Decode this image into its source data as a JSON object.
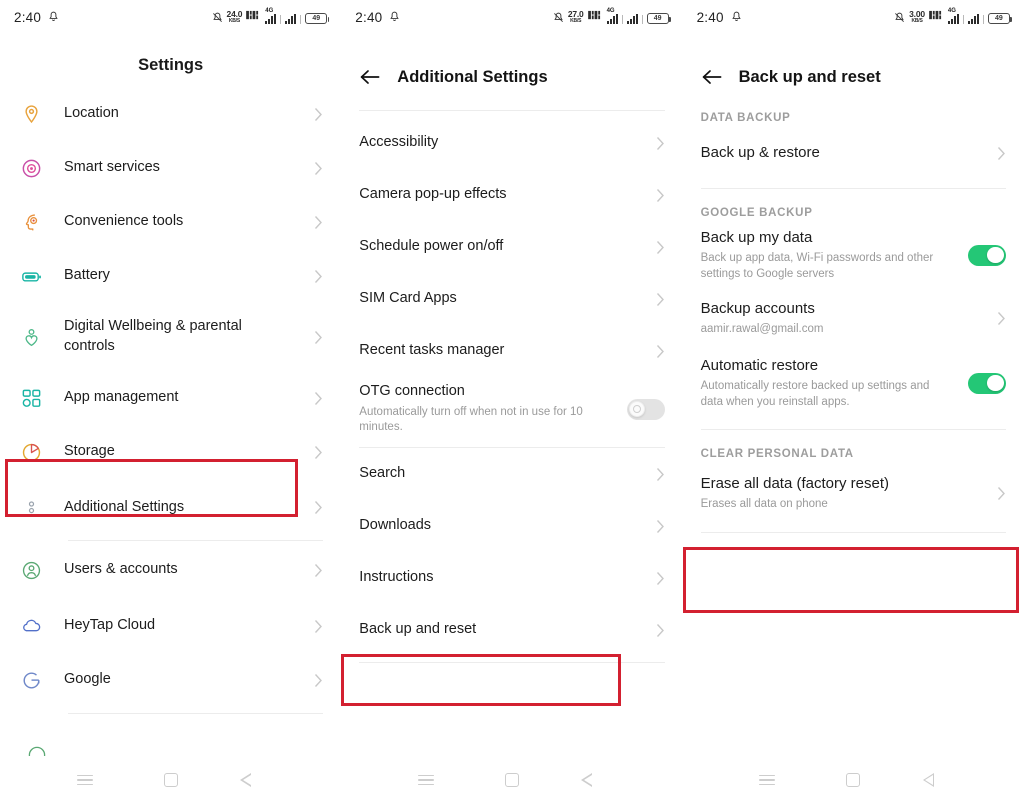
{
  "screens": [
    {
      "id": "settings",
      "status_bar": {
        "time": "2:40",
        "bell_icon": "bell-icon",
        "data_rate_value": "24.0",
        "data_rate_unit": "KB/S",
        "volte_icon": "volte-icon",
        "network_label": "4G",
        "signal_icon": "signal-bars-icon",
        "battery_level": "49"
      },
      "header": {
        "title": "Settings",
        "type": "center"
      },
      "items": [
        {
          "label": "Location",
          "icon": "location-pin-icon",
          "color": "#e8a33d",
          "chevron": true
        },
        {
          "label": "Smart services",
          "icon": "smart-services-icon",
          "color": "#e0509e",
          "chevron": true
        },
        {
          "label": "Convenience tools",
          "icon": "convenience-tools-icon",
          "color": "#e8913d",
          "chevron": true
        },
        {
          "label": "Battery",
          "icon": "battery-icon",
          "color": "#19b5a5",
          "chevron": true
        },
        {
          "label": "Digital Wellbeing & parental controls",
          "icon": "digital-wellbeing-icon",
          "color": "#4fb98a",
          "chevron": true
        },
        {
          "label": "App management",
          "icon": "app-management-icon",
          "color": "#19b5a5",
          "chevron": true
        },
        {
          "label": "Storage",
          "icon": "storage-pie-icon",
          "color": "#e3a72f",
          "chevron": true
        },
        {
          "label": "Additional Settings",
          "icon": "additional-settings-icon",
          "color": "#9aa3ad",
          "chevron": true,
          "highlighted": true
        },
        {
          "label": "Users & accounts",
          "icon": "users-accounts-icon",
          "color": "#5aa873",
          "chevron": true
        },
        {
          "label": "HeyTap Cloud",
          "icon": "cloud-icon",
          "color": "#5270c9",
          "chevron": true
        },
        {
          "label": "Google",
          "icon": "google-g-icon",
          "color": "#6f88c9",
          "chevron": true
        }
      ],
      "nav_bar": {
        "menu": "menu-icon",
        "home": "home-icon",
        "back": "back-icon"
      }
    },
    {
      "id": "additional-settings",
      "status_bar": {
        "time": "2:40",
        "bell_icon": "bell-icon",
        "data_rate_value": "27.0",
        "data_rate_unit": "KB/S",
        "volte_icon": "volte-icon",
        "network_label": "4G",
        "signal_icon": "signal-bars-icon",
        "battery_level": "49"
      },
      "header": {
        "title": "Additional Settings",
        "type": "back",
        "back_icon": "back-arrow-icon"
      },
      "items": [
        {
          "label": "Accessibility",
          "chevron": true
        },
        {
          "label": "Camera pop-up effects",
          "chevron": true
        },
        {
          "label": "Schedule power on/off",
          "chevron": true
        },
        {
          "label": "SIM Card Apps",
          "chevron": true
        },
        {
          "label": "Recent tasks manager",
          "chevron": true
        },
        {
          "label": "OTG connection",
          "sub": "Automatically turn off when not in use for 10 minutes.",
          "toggle": "off"
        },
        {
          "label": "Search",
          "chevron": true,
          "divider_before": true
        },
        {
          "label": "Downloads",
          "chevron": true
        },
        {
          "label": "Instructions",
          "chevron": true
        },
        {
          "label": "Back up and reset",
          "chevron": true,
          "highlighted": true
        }
      ],
      "nav_bar": {
        "menu": "menu-icon",
        "home": "home-icon",
        "back": "back-icon"
      }
    },
    {
      "id": "back-up-and-reset",
      "status_bar": {
        "time": "2:40",
        "bell_icon": "bell-icon",
        "data_rate_value": "3.00",
        "data_rate_unit": "KB/S",
        "volte_icon": "volte-icon",
        "network_label": "4G",
        "signal_icon": "signal-bars-icon",
        "battery_level": "49"
      },
      "header": {
        "title": "Back up and reset",
        "type": "back",
        "back_icon": "back-arrow-icon"
      },
      "sections": [
        {
          "title": "DATA BACKUP",
          "items": [
            {
              "label": "Back up & restore",
              "chevron": true
            }
          ]
        },
        {
          "title": "GOOGLE BACKUP",
          "items": [
            {
              "label": "Back up my data",
              "sub": "Back up app data, Wi-Fi passwords and other settings to Google servers",
              "toggle": "on"
            },
            {
              "label": "Backup accounts",
              "sub": "aamir.rawal@gmail.com",
              "chevron": true
            },
            {
              "label": "Automatic restore",
              "sub": "Automatically restore backed up settings and data when you reinstall apps.",
              "toggle": "on"
            }
          ]
        },
        {
          "title": "CLEAR PERSONAL DATA",
          "items": [
            {
              "label": "Erase all data (factory reset)",
              "sub": "Erases all data on phone",
              "chevron": true,
              "highlighted": true
            }
          ]
        }
      ],
      "nav_bar": {
        "menu": "menu-icon",
        "home": "home-icon",
        "back": "back-icon"
      }
    }
  ],
  "colors": {
    "highlight_box": "#d32030",
    "toggle_on": "#24c776",
    "toggle_off": "#e3e3e3",
    "text_primary": "#1c1c1c",
    "text_secondary": "#9a9a9a"
  }
}
